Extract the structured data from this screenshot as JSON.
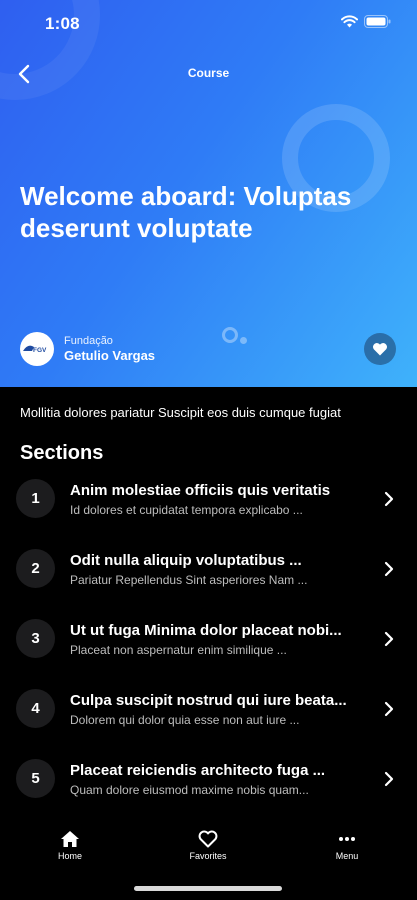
{
  "status_bar": {
    "time": "1:08"
  },
  "header": {
    "nav_title": "Course",
    "course_title": "Welcome aboard: Voluptas deserunt voluptate",
    "provider_line1": "Fundação",
    "provider_line2": "Getulio Vargas",
    "provider_logo_text": "FGV"
  },
  "description": "Mollitia dolores pariatur Suscipit eos duis cumque fugiat",
  "sections_title": "Sections",
  "sections": [
    {
      "num": "1",
      "title": "Anim molestiae officiis quis veritatis",
      "subtitle": "Id dolores et cupidatat tempora explicabo ..."
    },
    {
      "num": "2",
      "title": "Odit nulla aliquip voluptatibus ...",
      "subtitle": "Pariatur Repellendus Sint asperiores Nam ..."
    },
    {
      "num": "3",
      "title": "Ut ut fuga Minima dolor placeat nobi...",
      "subtitle": "Placeat non aspernatur enim similique ..."
    },
    {
      "num": "4",
      "title": "Culpa suscipit nostrud qui iure beata...",
      "subtitle": "Dolorem qui dolor quia esse non aut iure ..."
    },
    {
      "num": "5",
      "title": "Placeat reiciendis architecto fuga ...",
      "subtitle": "Quam dolore eiusmod maxime nobis quam..."
    }
  ],
  "tab_bar": {
    "home": "Home",
    "favorites": "Favorites",
    "menu": "Menu"
  },
  "colors": {
    "gradient_start": "#2f5ff0",
    "gradient_end": "#3fb2fb",
    "background": "#000000",
    "badge_bg": "#1c1c1e"
  }
}
